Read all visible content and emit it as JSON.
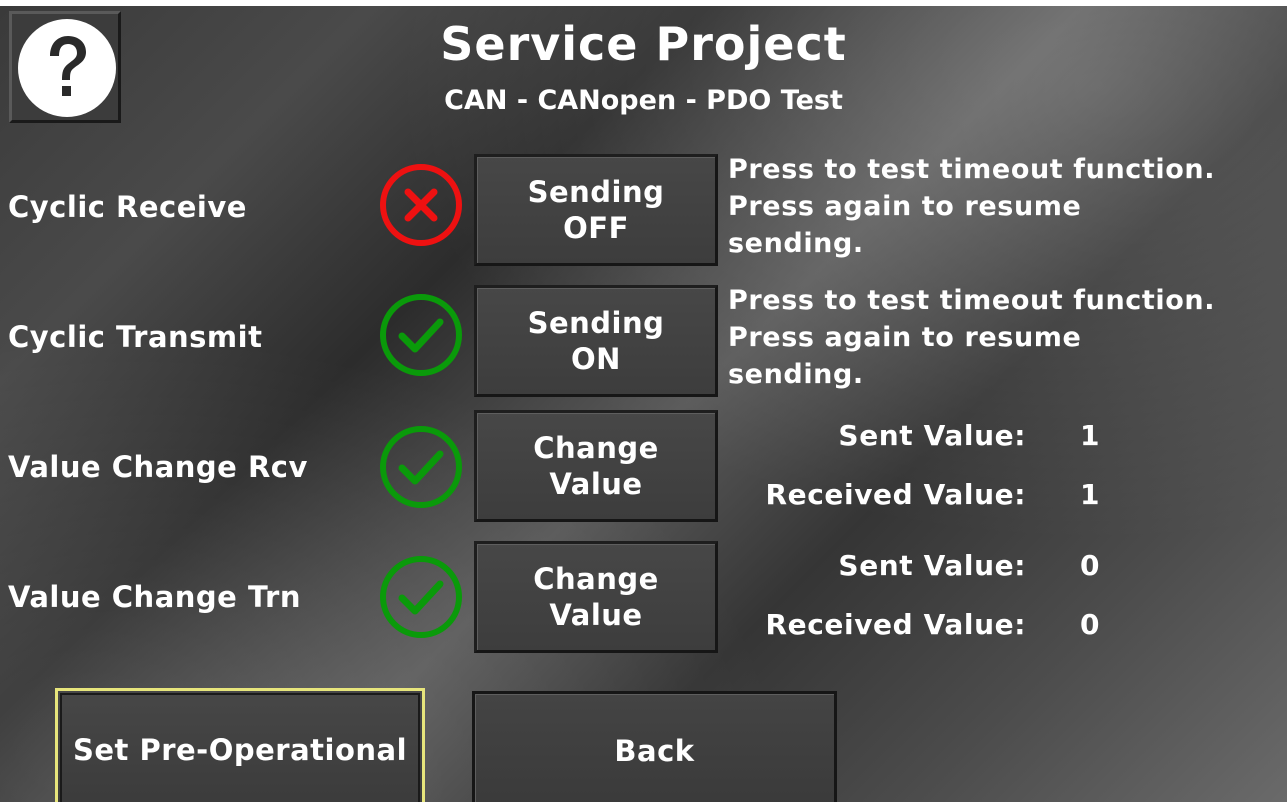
{
  "header": {
    "title": "Service Project",
    "subtitle": "CAN - CANopen - PDO Test",
    "help_icon": "question-mark-icon"
  },
  "rows": [
    {
      "label": "Cyclic Receive",
      "status": "error",
      "status_icon": "x-circle-icon",
      "button_line1": "Sending",
      "button_line2": "OFF",
      "description": [
        "Press to test timeout function.",
        "Press again to resume",
        "sending."
      ]
    },
    {
      "label": "Cyclic Transmit",
      "status": "ok",
      "status_icon": "check-circle-icon",
      "button_line1": "Sending",
      "button_line2": "ON",
      "description": [
        "Press to test timeout function.",
        "Press again to resume",
        "sending."
      ]
    },
    {
      "label": "Value Change Rcv",
      "status": "ok",
      "status_icon": "check-circle-icon",
      "button_line1": "Change",
      "button_line2": "Value",
      "sent_label": "Sent Value:",
      "sent_value": "1",
      "received_label": "Received Value:",
      "received_value": "1"
    },
    {
      "label": "Value Change Trn",
      "status": "ok",
      "status_icon": "check-circle-icon",
      "button_line1": "Change",
      "button_line2": "Value",
      "sent_label": "Sent Value:",
      "sent_value": "0",
      "received_label": "Received Value:",
      "received_value": "0"
    }
  ],
  "footer": {
    "preop_label": "Set Pre-Operational",
    "back_label": "Back"
  },
  "colors": {
    "ok": "#0a9a0a",
    "error": "#ee1111",
    "focus_border": "#e7e57c"
  }
}
